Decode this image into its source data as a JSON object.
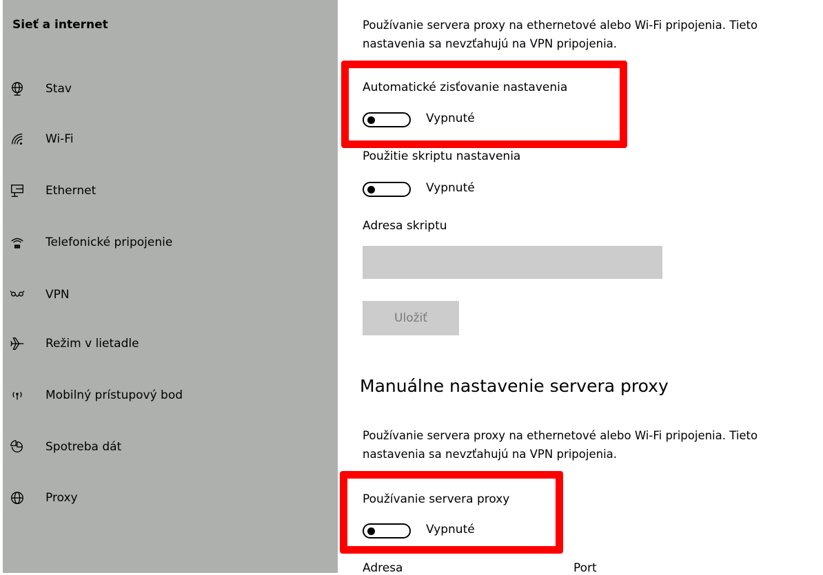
{
  "sidebar": {
    "title": "Sieť a internet",
    "items": [
      {
        "label": "Stav",
        "icon": "globe-status-icon"
      },
      {
        "label": "Wi-Fi",
        "icon": "wifi-icon"
      },
      {
        "label": "Ethernet",
        "icon": "ethernet-icon"
      },
      {
        "label": "Telefonické pripojenie",
        "icon": "dialup-icon"
      },
      {
        "label": "VPN",
        "icon": "vpn-icon"
      },
      {
        "label": "Režim v lietadle",
        "icon": "airplane-icon"
      },
      {
        "label": "Mobilný prístupový bod",
        "icon": "hotspot-icon"
      },
      {
        "label": "Spotreba dát",
        "icon": "data-usage-icon"
      },
      {
        "label": "Proxy",
        "icon": "globe-icon"
      }
    ]
  },
  "automatic": {
    "description_line1": "Používanie servera proxy na ethernetové alebo Wi-Fi pripojenia. Tieto",
    "description_line2": "nastavenia sa nevzťahujú na VPN pripojenia.",
    "detect_label": "Automatické zisťovanie nastavenia",
    "detect_state": "Vypnuté",
    "script_label": "Použitie skriptu nastavenia",
    "script_state": "Vypnuté",
    "address_label": "Adresa skriptu",
    "address_value": "",
    "save_label": "Uložiť"
  },
  "manual": {
    "heading": "Manuálne nastavenie servera proxy",
    "description_line1": "Používanie servera proxy na ethernetové alebo Wi-Fi pripojenia. Tieto",
    "description_line2": "nastavenia sa nevzťahujú na VPN pripojenia.",
    "use_proxy_label": "Používanie servera proxy",
    "use_proxy_state": "Vypnuté",
    "address_label": "Adresa",
    "port_label": "Port"
  },
  "colors": {
    "sidebar_bg": "#aeb0ae",
    "highlight": "#ff0000",
    "disabled_control": "#cccccc"
  }
}
